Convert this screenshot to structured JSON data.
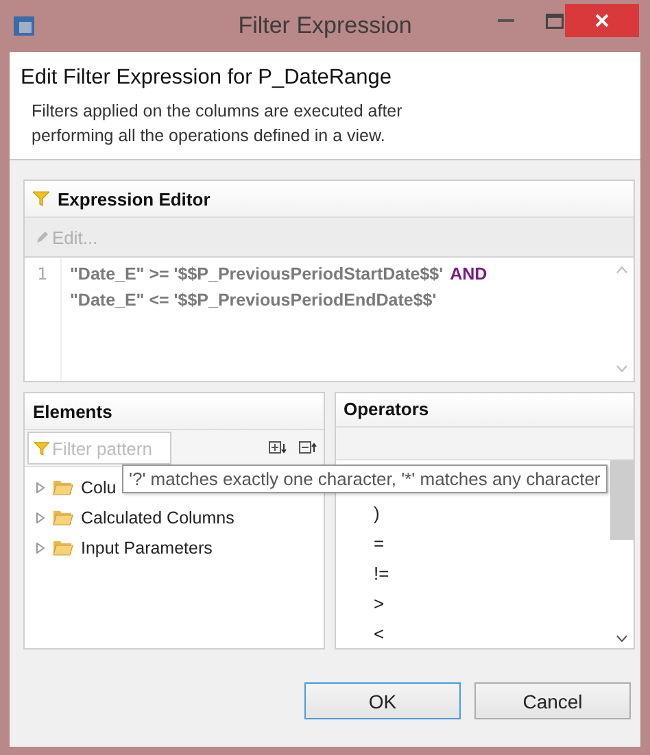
{
  "window": {
    "title": "Filter Expression"
  },
  "header": {
    "title": "Edit Filter Expression for P_DateRange",
    "description": "Filters applied on the columns are executed after performing all the operations defined in a view."
  },
  "expression_editor": {
    "title": "Expression Editor",
    "edit_button": {
      "label": "Edit...",
      "disabled": true
    },
    "lines": [
      {
        "number": "1",
        "tokens": [
          {
            "kind": "text",
            "text": "\"Date_E\" >= '$$P_PreviousPeriodStartDate$$'"
          },
          {
            "kind": "keyword",
            "text": "AND"
          }
        ]
      },
      {
        "tokens": [
          {
            "kind": "text",
            "text": "\"Date_E\" <= '$$P_PreviousPeriodEndDate$$'"
          }
        ]
      }
    ]
  },
  "elements": {
    "title": "Elements",
    "filter": {
      "placeholder": "Filter pattern"
    },
    "items": [
      {
        "label": "Colu",
        "expanded": false
      },
      {
        "label": "Calculated Columns",
        "expanded": false
      },
      {
        "label": "Input Parameters",
        "expanded": false
      }
    ]
  },
  "operators": {
    "title": "Operators",
    "items": [
      ")",
      "=",
      "!=",
      ">",
      "<"
    ]
  },
  "tooltip": "'?' matches exactly one character, '*' matches any character",
  "buttons": [
    {
      "label": "OK",
      "default": true
    },
    {
      "label": "Cancel",
      "default": false
    }
  ]
}
